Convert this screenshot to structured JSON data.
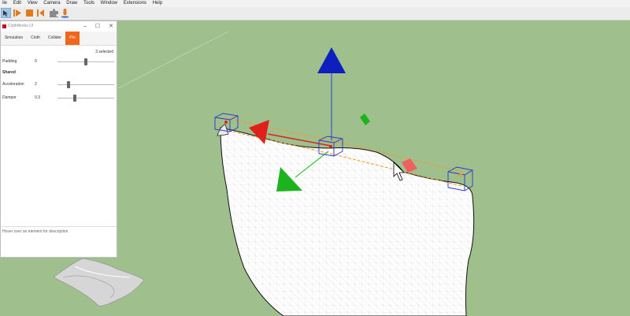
{
  "menu": {
    "items": [
      "ile",
      "Edit",
      "View",
      "Camera",
      "Draw",
      "Tools",
      "Window",
      "Extensions",
      "Help"
    ]
  },
  "toolbar": {
    "buttons": [
      "select-icon",
      "play-icon",
      "stop-icon",
      "rewind-icon",
      "puzzle-icon",
      "figure-icon"
    ]
  },
  "panel": {
    "title": "ClothWorks UI",
    "tabs": [
      {
        "label": "Simulation",
        "active": false
      },
      {
        "label": "Cloth",
        "active": false
      },
      {
        "label": "Collider",
        "active": false
      },
      {
        "label": "Pin",
        "active": true
      }
    ],
    "selected_count": "3 selected",
    "padding_label": "Padding",
    "padding_value": "0",
    "padding_level": 0.5,
    "shared_heading": "Shared",
    "acceleration_label": "Acceleration",
    "acceleration_value": "2",
    "acceleration_level": 0.2,
    "damper_label": "Damper",
    "damper_value": "0.3",
    "damper_level": 0.3,
    "description": "Hover over an element for description"
  },
  "colors": {
    "viewport_bg": "#9fbf8c",
    "accent": "#f0661b",
    "axis_red": "#e0201a",
    "axis_green": "#1db31d",
    "axis_blue": "#0d1fbf",
    "pin_box": "#2a36c9"
  }
}
